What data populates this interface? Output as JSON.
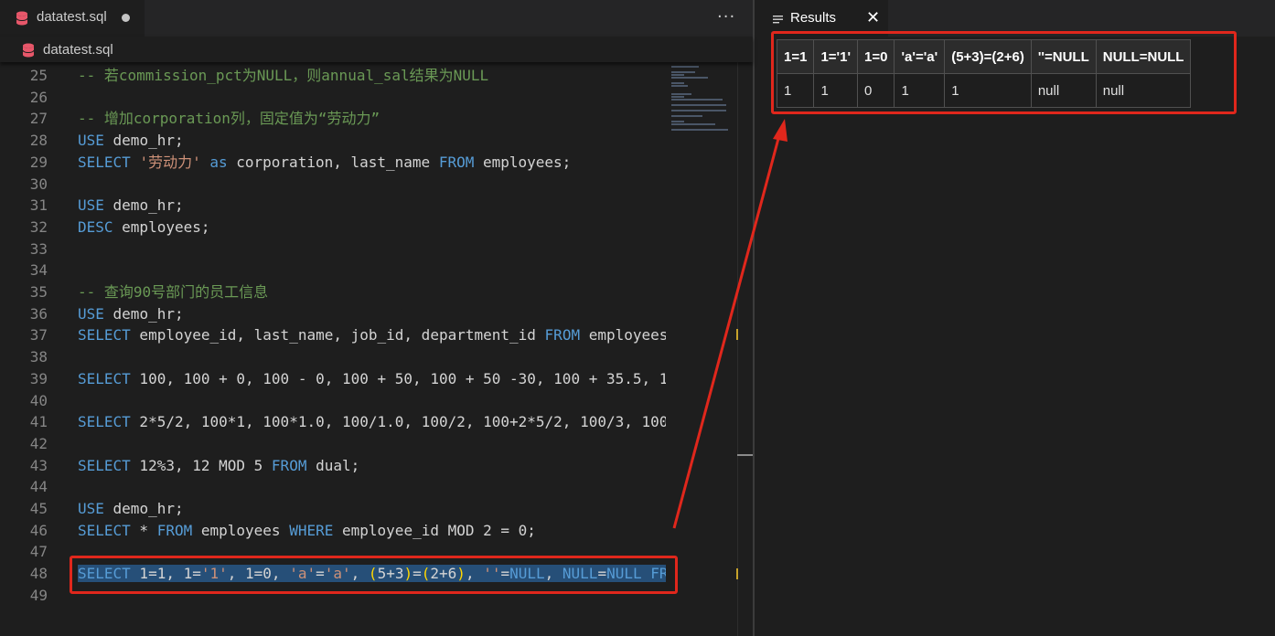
{
  "editor": {
    "tab_label": "datatest.sql",
    "breadcrumb_label": "datatest.sql",
    "more_actions": "···",
    "lines": [
      {
        "n": "25",
        "tokens": [
          {
            "t": "-- 若commission_pct为NULL，则annual_sal结果为NULL",
            "c": "cmt"
          }
        ]
      },
      {
        "n": "26",
        "tokens": []
      },
      {
        "n": "27",
        "tokens": [
          {
            "t": "-- 增加corporation列，固定值为“劳动力”",
            "c": "cmt"
          }
        ]
      },
      {
        "n": "28",
        "tokens": [
          {
            "t": "USE",
            "c": "kw"
          },
          {
            "t": " demo_hr;",
            "c": ""
          }
        ]
      },
      {
        "n": "29",
        "tokens": [
          {
            "t": "SELECT",
            "c": "kw"
          },
          {
            "t": " ",
            "c": ""
          },
          {
            "t": "'劳动力'",
            "c": "str"
          },
          {
            "t": " ",
            "c": ""
          },
          {
            "t": "as",
            "c": "kw"
          },
          {
            "t": " corporation, last_name ",
            "c": ""
          },
          {
            "t": "FROM",
            "c": "kw"
          },
          {
            "t": " employees;",
            "c": ""
          }
        ]
      },
      {
        "n": "30",
        "tokens": []
      },
      {
        "n": "31",
        "tokens": [
          {
            "t": "USE",
            "c": "kw"
          },
          {
            "t": " demo_hr;",
            "c": ""
          }
        ]
      },
      {
        "n": "32",
        "tokens": [
          {
            "t": "DESC",
            "c": "kw"
          },
          {
            "t": " employees;",
            "c": ""
          }
        ]
      },
      {
        "n": "33",
        "tokens": []
      },
      {
        "n": "34",
        "tokens": []
      },
      {
        "n": "35",
        "tokens": [
          {
            "t": "-- 查询90号部门的员工信息",
            "c": "cmt"
          }
        ]
      },
      {
        "n": "36",
        "tokens": [
          {
            "t": "USE",
            "c": "kw"
          },
          {
            "t": " demo_hr;",
            "c": ""
          }
        ]
      },
      {
        "n": "37",
        "tokens": [
          {
            "t": "SELECT",
            "c": "kw"
          },
          {
            "t": " employee_id, last_name, job_id, department_id ",
            "c": ""
          },
          {
            "t": "FROM",
            "c": "kw"
          },
          {
            "t": " employees",
            "c": ""
          }
        ]
      },
      {
        "n": "38",
        "tokens": []
      },
      {
        "n": "39",
        "tokens": [
          {
            "t": "SELECT",
            "c": "kw"
          },
          {
            "t": " 100, 100 + 0, 100 - 0, 100 + 50, 100 + 50 -30, 100 + 35.5, 1",
            "c": ""
          }
        ]
      },
      {
        "n": "40",
        "tokens": []
      },
      {
        "n": "41",
        "tokens": [
          {
            "t": "SELECT",
            "c": "kw"
          },
          {
            "t": " 2*5/2, 100*1, 100*1.0, 100/1.0, 100/2, 100+2*5/2, 100/3, 100",
            "c": ""
          }
        ]
      },
      {
        "n": "42",
        "tokens": []
      },
      {
        "n": "43",
        "tokens": [
          {
            "t": "SELECT",
            "c": "kw"
          },
          {
            "t": " 12%3, 12 MOD 5 ",
            "c": ""
          },
          {
            "t": "FROM",
            "c": "kw"
          },
          {
            "t": " dual;",
            "c": ""
          }
        ]
      },
      {
        "n": "44",
        "tokens": []
      },
      {
        "n": "45",
        "tokens": [
          {
            "t": "USE",
            "c": "kw"
          },
          {
            "t": " demo_hr;",
            "c": ""
          }
        ]
      },
      {
        "n": "46",
        "tokens": [
          {
            "t": "SELECT",
            "c": "kw"
          },
          {
            "t": " * ",
            "c": ""
          },
          {
            "t": "FROM",
            "c": "kw"
          },
          {
            "t": " employees ",
            "c": ""
          },
          {
            "t": "WHERE",
            "c": "kw"
          },
          {
            "t": " employee_id MOD 2 = 0;",
            "c": ""
          }
        ]
      },
      {
        "n": "47",
        "tokens": []
      },
      {
        "n": "48",
        "selected": true,
        "tokens": [
          {
            "t": "SELECT",
            "c": "kw"
          },
          {
            "t": " 1=1, 1=",
            "c": ""
          },
          {
            "t": "'1'",
            "c": "str"
          },
          {
            "t": ", 1=0, ",
            "c": ""
          },
          {
            "t": "'a'",
            "c": "str"
          },
          {
            "t": "=",
            "c": ""
          },
          {
            "t": "'a'",
            "c": "str"
          },
          {
            "t": ", ",
            "c": ""
          },
          {
            "t": "(",
            "c": "br"
          },
          {
            "t": "5+3",
            "c": ""
          },
          {
            "t": ")",
            "c": "br"
          },
          {
            "t": "=",
            "c": ""
          },
          {
            "t": "(",
            "c": "br"
          },
          {
            "t": "2+6",
            "c": ""
          },
          {
            "t": ")",
            "c": "br"
          },
          {
            "t": ", ",
            "c": ""
          },
          {
            "t": "''",
            "c": "str"
          },
          {
            "t": "=",
            "c": ""
          },
          {
            "t": "NULL",
            "c": "kw"
          },
          {
            "t": ", ",
            "c": ""
          },
          {
            "t": "NULL",
            "c": "kw"
          },
          {
            "t": "=",
            "c": ""
          },
          {
            "t": "NULL",
            "c": "kw"
          },
          {
            "t": " ",
            "c": ""
          },
          {
            "t": "FR",
            "c": "kw"
          }
        ]
      },
      {
        "n": "49",
        "tokens": []
      }
    ]
  },
  "results": {
    "tab_label": "Results",
    "close_glyph": "✕",
    "columns": [
      "1=1",
      "1='1'",
      "1=0",
      "'a'='a'",
      "(5+3)=(2+6)",
      "''=NULL",
      "NULL=NULL"
    ],
    "rows": [
      [
        "1",
        "1",
        "0",
        "1",
        "1",
        "null",
        "null"
      ]
    ]
  },
  "colors": {
    "annotation": "#e0271c",
    "selection": "#264f78",
    "keyword": "#569cd6",
    "string": "#ce9178",
    "comment": "#6a9955"
  },
  "icons": {
    "tab": "database-icon",
    "results": "list-icon",
    "close": "close-icon",
    "more": "more-actions-icon"
  }
}
